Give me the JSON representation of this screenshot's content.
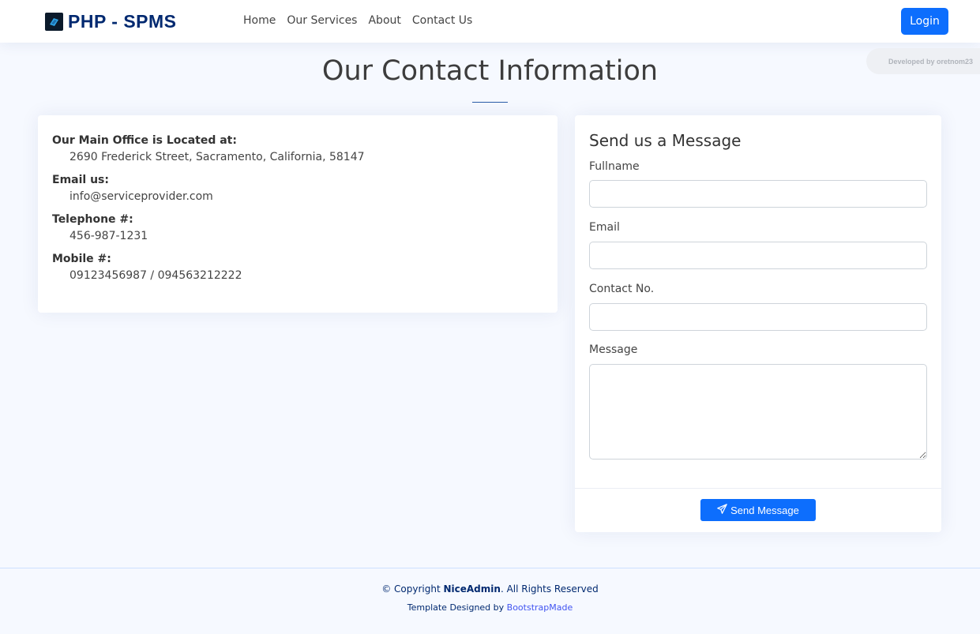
{
  "header": {
    "brand": "PHP - SPMS",
    "nav": [
      "Home",
      "Our Services",
      "About",
      "Contact Us"
    ],
    "login_label": "Login"
  },
  "badge": "Developed by oretnom23",
  "page": {
    "title": "Our Contact Information"
  },
  "contact_info": [
    {
      "label": "Our Main Office is Located at:",
      "value": "2690 Frederick Street, Sacramento, California, 58147"
    },
    {
      "label": "Email us:",
      "value": "info@serviceprovider.com"
    },
    {
      "label": "Telephone #:",
      "value": "456-987-1231"
    },
    {
      "label": "Mobile #:",
      "value": "09123456987 / 094563212222"
    }
  ],
  "message_form": {
    "title": "Send us a Message",
    "fields": {
      "fullname": {
        "label": "Fullname",
        "value": ""
      },
      "email": {
        "label": "Email",
        "value": ""
      },
      "contact": {
        "label": "Contact No.",
        "value": ""
      },
      "message": {
        "label": "Message",
        "value": ""
      }
    },
    "submit_label": "Send Message",
    "submit_icon": "send-icon"
  },
  "footer": {
    "copyright_prefix": "© Copyright ",
    "copyright_brand": "NiceAdmin",
    "copyright_suffix": ". All Rights Reserved",
    "credits_prefix": "Template Designed by ",
    "credits_link": "BootstrapMade"
  },
  "colors": {
    "primary": "#0d6efd",
    "brand": "#012970",
    "background": "#f6f9ff"
  }
}
